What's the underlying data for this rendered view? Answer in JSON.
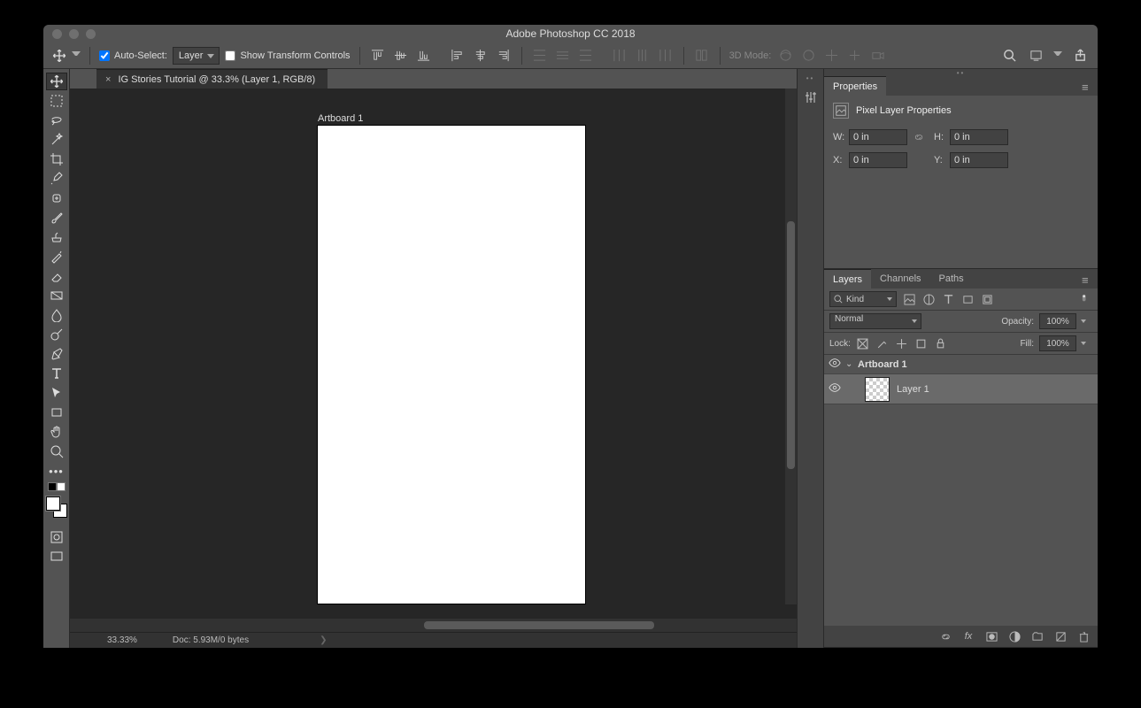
{
  "title": "Adobe Photoshop CC 2018",
  "options": {
    "auto_select_label": "Auto-Select:",
    "auto_select_target": "Layer",
    "show_transform_label": "Show Transform Controls",
    "mode3d_label": "3D Mode:"
  },
  "document": {
    "tab_title": "IG Stories Tutorial @ 33.3% (Layer 1, RGB/8)",
    "artboard_label": "Artboard 1"
  },
  "status": {
    "zoom": "33.33%",
    "doc_info": "Doc: 5.93M/0 bytes"
  },
  "properties": {
    "tab": "Properties",
    "heading": "Pixel Layer Properties",
    "W_label": "W:",
    "W_value": "0 in",
    "H_label": "H:",
    "H_value": "0 in",
    "X_label": "X:",
    "X_value": "0 in",
    "Y_label": "Y:",
    "Y_value": "0 in"
  },
  "layers_panel": {
    "tabs": {
      "layers": "Layers",
      "channels": "Channels",
      "paths": "Paths"
    },
    "kind_label": "Kind",
    "blend_mode": "Normal",
    "opacity_label": "Opacity:",
    "opacity_value": "100%",
    "lock_label": "Lock:",
    "fill_label": "Fill:",
    "fill_value": "100%",
    "artboard_name": "Artboard 1",
    "layer_name": "Layer 1"
  }
}
